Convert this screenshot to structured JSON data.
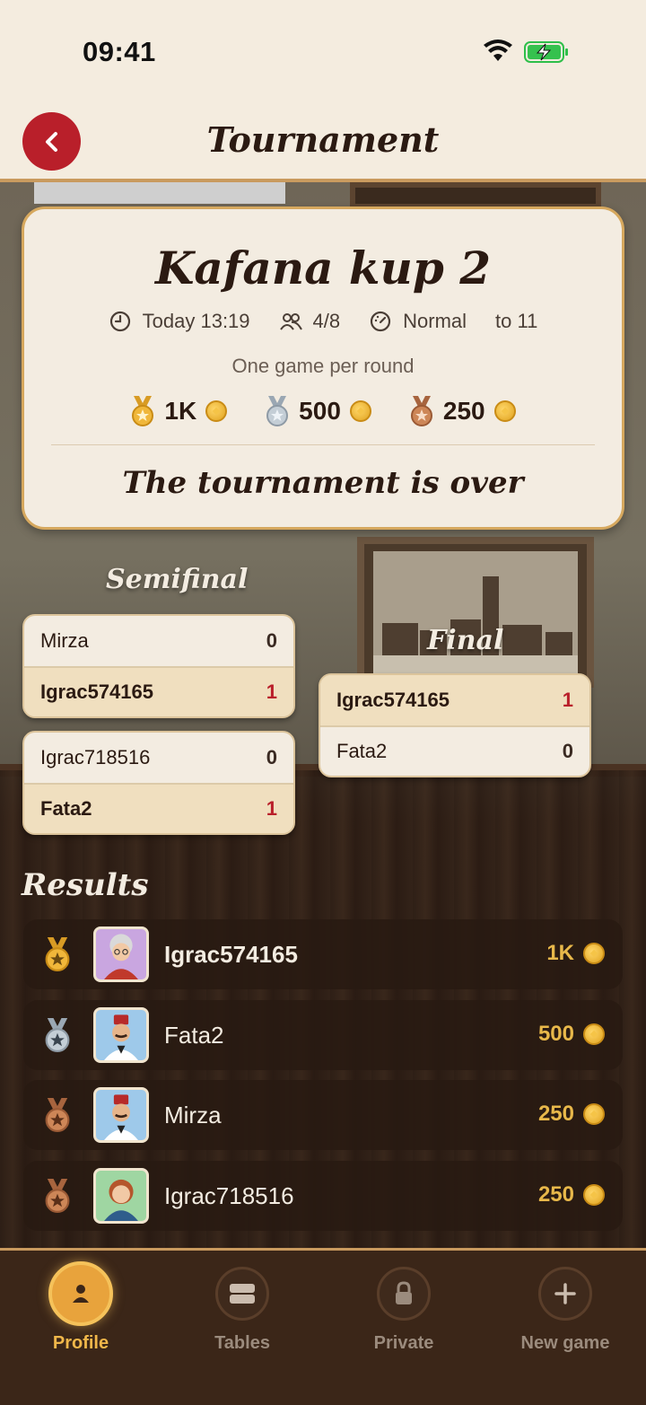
{
  "status_bar": {
    "time": "09:41"
  },
  "header": {
    "title": "Tournament"
  },
  "tournament": {
    "name": "Kafana kup 2",
    "start": "Today 13:19",
    "players": "4/8",
    "speed": "Normal",
    "target": "to 11",
    "format": "One game per round",
    "prizes": [
      {
        "medal": "gold",
        "amount": "1K"
      },
      {
        "medal": "silver",
        "amount": "500"
      },
      {
        "medal": "bronze",
        "amount": "250"
      }
    ],
    "status": "The tournament is over"
  },
  "bracket": {
    "semifinal_title": "Semifinal",
    "final_title": "Final",
    "semifinals": [
      {
        "p1": "Mirza",
        "s1": "0",
        "p2": "Igrac574165",
        "s2": "1"
      },
      {
        "p1": "Igrac718516",
        "s1": "0",
        "p2": "Fata2",
        "s2": "1"
      }
    ],
    "final": {
      "p1": "Igrac574165",
      "s1": "1",
      "p2": "Fata2",
      "s2": "0"
    }
  },
  "results": {
    "title": "Results",
    "rows": [
      {
        "medal": "gold",
        "name": "Igrac574165",
        "amount": "1K",
        "avatar": "grandma-avatar"
      },
      {
        "medal": "silver",
        "name": "Fata2",
        "amount": "500",
        "avatar": "man-fez-avatar"
      },
      {
        "medal": "bronze",
        "name": "Mirza",
        "amount": "250",
        "avatar": "man-fez-avatar"
      },
      {
        "medal": "bronze",
        "name": "Igrac718516",
        "amount": "250",
        "avatar": "woman-avatar"
      }
    ]
  },
  "nav": {
    "items": [
      {
        "label": "Profile",
        "icon": "person-icon",
        "active": true
      },
      {
        "label": "Tables",
        "icon": "tables-icon",
        "active": false
      },
      {
        "label": "Private",
        "icon": "lock-icon",
        "active": false
      },
      {
        "label": "New game",
        "icon": "plus-icon",
        "active": false
      }
    ]
  },
  "colors": {
    "accent": "#b91f2a",
    "gold": "#e8b84a",
    "card": "#f3ece1",
    "border": "#d6a85e"
  }
}
